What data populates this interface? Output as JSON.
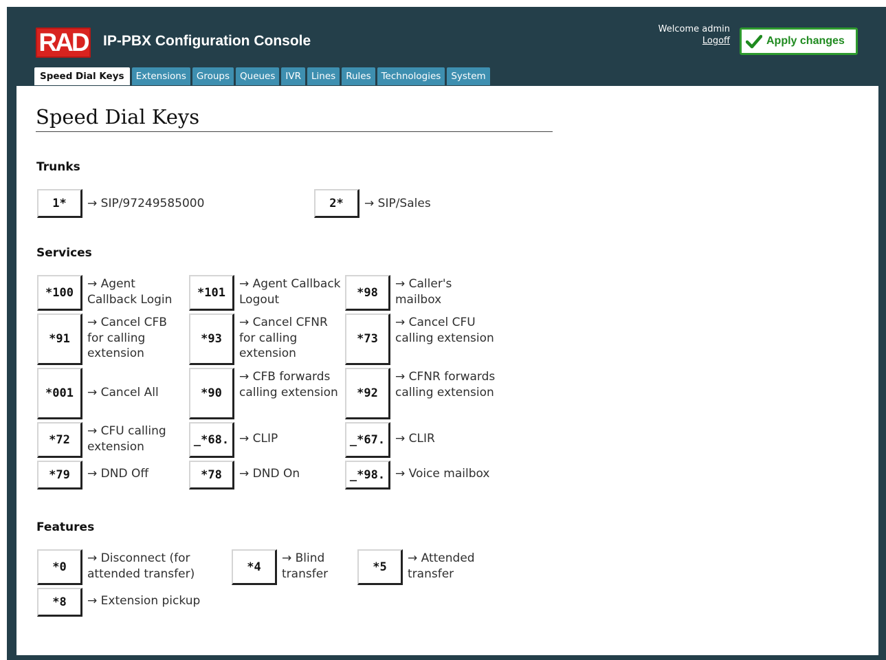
{
  "header": {
    "logo_text": "RAD",
    "app_title": "IP-PBX Configuration Console",
    "welcome": "Welcome admin",
    "logoff": "Logoff",
    "apply_changes": "Apply changes",
    "accent_green": "#2e9a2e",
    "frame_color": "#243f4a",
    "tab_color": "#3e8fb0",
    "logo_color": "#d8231f"
  },
  "tabs": [
    {
      "label": "Speed Dial Keys",
      "active": true
    },
    {
      "label": "Extensions"
    },
    {
      "label": "Groups"
    },
    {
      "label": "Queues"
    },
    {
      "label": "IVR"
    },
    {
      "label": "Lines"
    },
    {
      "label": "Rules"
    },
    {
      "label": "Technologies"
    },
    {
      "label": "System"
    }
  ],
  "page_title": "Speed Dial Keys",
  "sections": {
    "trunks": {
      "heading": "Trunks",
      "items": [
        {
          "key": "1*",
          "desc": "→ SIP/97249585000"
        },
        {
          "key": "2*",
          "desc": "→ SIP/Sales"
        }
      ]
    },
    "services": {
      "heading": "Services",
      "items": [
        {
          "key": "*100",
          "desc": "→ Agent Callback Login"
        },
        {
          "key": "*101",
          "desc": "→ Agent Callback Logout"
        },
        {
          "key": "*98",
          "desc": "→ Caller's mailbox"
        },
        {
          "key": "*91",
          "desc": "→ Cancel CFB for calling extension"
        },
        {
          "key": "*93",
          "desc": "→ Cancel CFNR for calling extension"
        },
        {
          "key": "*73",
          "desc": "→ Cancel CFU calling extension"
        },
        {
          "key": "*001",
          "desc": "→ Cancel All"
        },
        {
          "key": "*90",
          "desc": "→ CFB forwards calling extension"
        },
        {
          "key": "*92",
          "desc": "→ CFNR forwards calling extension"
        },
        {
          "key": "*72",
          "desc": "→ CFU calling extension"
        },
        {
          "key": "_*68.",
          "desc": "→ CLIP"
        },
        {
          "key": "_*67.",
          "desc": "→ CLIR"
        },
        {
          "key": "*79",
          "desc": "→ DND Off"
        },
        {
          "key": "*78",
          "desc": "→ DND On"
        },
        {
          "key": "_*98.",
          "desc": "→ Voice mailbox"
        }
      ]
    },
    "features": {
      "heading": "Features",
      "items": [
        {
          "key": "*0",
          "desc": "→ Disconnect (for attended transfer)"
        },
        {
          "key": "*4",
          "desc": "→ Blind transfer"
        },
        {
          "key": "*5",
          "desc": "→ Attended transfer"
        },
        {
          "key": "*8",
          "desc": "→ Extension pickup"
        }
      ]
    }
  }
}
